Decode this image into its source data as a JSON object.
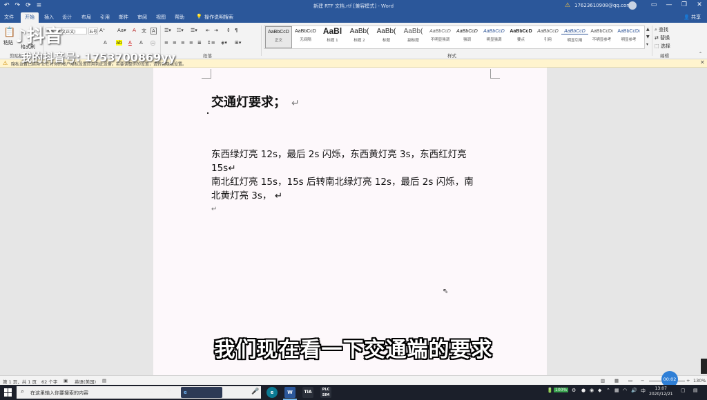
{
  "titlebar": {
    "title": "新建 RTF 文档.rtf [兼容模式] - Word",
    "account": "17623610908@qq.com",
    "qat": [
      "↶",
      "↷",
      "⟳",
      "≡"
    ]
  },
  "tabs": [
    "文件",
    "开始",
    "插入",
    "设计",
    "布局",
    "引用",
    "邮件",
    "审阅",
    "视图",
    "帮助",
    "操作说明搜索"
  ],
  "active_tab": "开始",
  "share": "共享",
  "ribbon": {
    "paste": "粘贴",
    "format_painter": "格式刷",
    "font_name": "等线 (中文正文)",
    "font_size": "五号",
    "group_clipboard": "剪贴板",
    "group_paragraph": "段落",
    "group_styles": "样式",
    "group_editing": "编辑",
    "find": "查找",
    "replace": "替换",
    "select": "选择",
    "styles": [
      {
        "sample": "AaBbCcD",
        "name": "正文"
      },
      {
        "sample": "AaBbCcD",
        "name": "无间隔"
      },
      {
        "sample": "AaBl",
        "name": "标题 1"
      },
      {
        "sample": "AaBb(",
        "name": "标题 2"
      },
      {
        "sample": "AaBb(",
        "name": "标题"
      },
      {
        "sample": "AaBb(",
        "name": "副标题"
      },
      {
        "sample": "AaBbCcD",
        "name": "不明显强调"
      },
      {
        "sample": "AaBbCcD",
        "name": "强调"
      },
      {
        "sample": "AaBbCcD",
        "name": "明显强调"
      },
      {
        "sample": "AaBbCcD",
        "name": "要点"
      },
      {
        "sample": "AaBbCcD",
        "name": "引用"
      },
      {
        "sample": "AaBbCcD",
        "name": "明显引用"
      },
      {
        "sample": "AaBbCcDi",
        "name": "不明显参考"
      },
      {
        "sample": "AaBbCcDi",
        "name": "明显参考"
      }
    ]
  },
  "message_bar": {
    "text": "隐私设置已启用   正在将你的帐户隐私设置应用到此设备。若要调整你的设置，请转到隐私设置。"
  },
  "document": {
    "heading": "交通灯要求；",
    "para_mark": "↵",
    "lines": [
      "东西绿灯亮 12s，最后 2s 闪烁，东西黄灯亮 3s，东西红灯亮",
      "15s↵",
      "南北红灯亮 15s，15s 后转南北绿灯亮 12s，最后 2s 闪烁，南",
      "北黄灯亮 3s，  ↵",
      "↵"
    ]
  },
  "caption": "我们现在看一下交通端的要求",
  "watermark": {
    "logo": "抖音",
    "account": "我的抖音号: 1753700869yy"
  },
  "statusbar": {
    "page": "第 1 页，共 1 页",
    "words": "62 个字",
    "language": "英语(美国)",
    "zoom": "130%",
    "timer": "00:02"
  },
  "taskbar": {
    "search_placeholder": "在这里输入你要搜索的内容",
    "apps": [
      "e",
      "W",
      "TIA",
      "PLC SIM"
    ],
    "battery": "100%",
    "ime": "中",
    "time": "13:07",
    "date": "2020/12/21"
  }
}
